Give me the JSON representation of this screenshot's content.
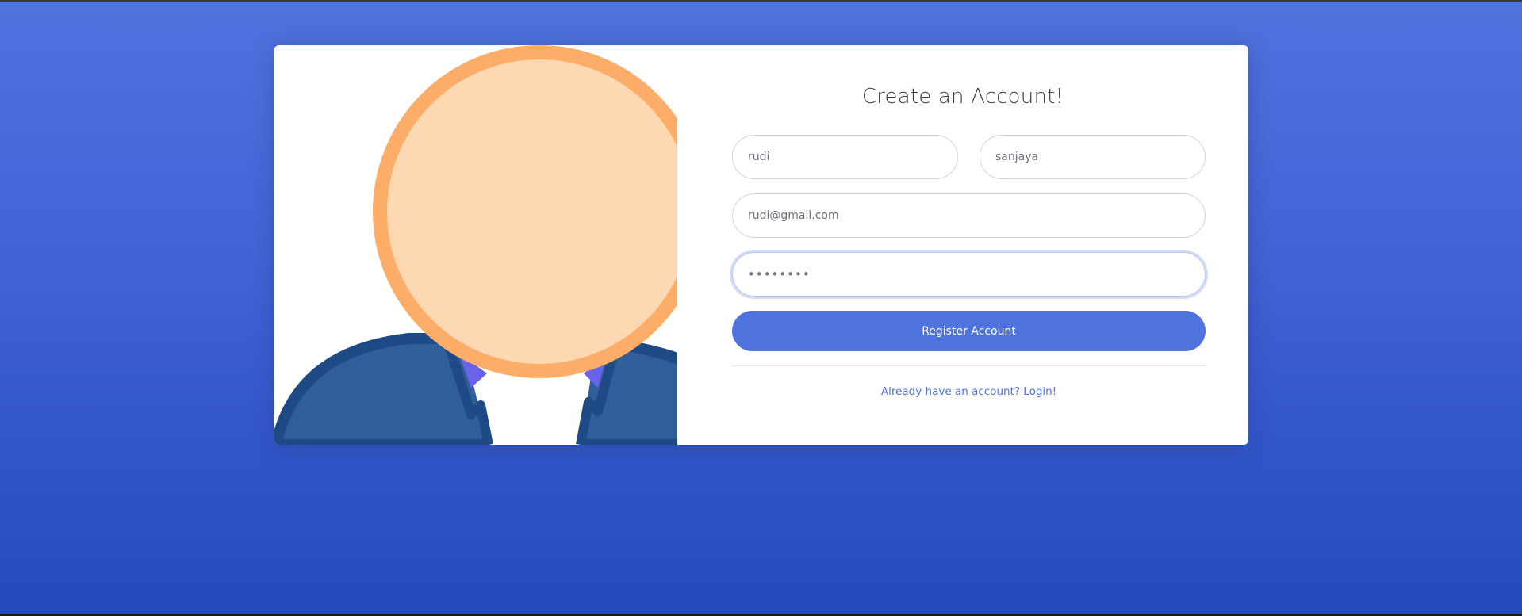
{
  "register_form": {
    "title": "Create an Account!",
    "first_name": {
      "value": "rudi"
    },
    "last_name": {
      "value": "sanjaya"
    },
    "email": {
      "value": "rudi@gmail.com"
    },
    "password": {
      "masked_value": "••••••••"
    },
    "register_button_label": "Register Account",
    "login_link_label": "Already have an account? Login!"
  },
  "illustration": {
    "icon": "user-avatar-icon",
    "colors": {
      "head_fill": "#fed7b3",
      "head_outline": "#fead68",
      "suit_fill": "#2e5f99",
      "suit_outline": "#1e4a86",
      "shirt": "#ffffff",
      "collar_accent": "#6b62ec"
    }
  },
  "theme": {
    "background_top": "#4e73df",
    "background_bottom": "#224abe",
    "accent": "#4e73df",
    "title_color": "#3a3b45",
    "input_border": "#d1d3e2",
    "input_text": "#6e707e"
  }
}
